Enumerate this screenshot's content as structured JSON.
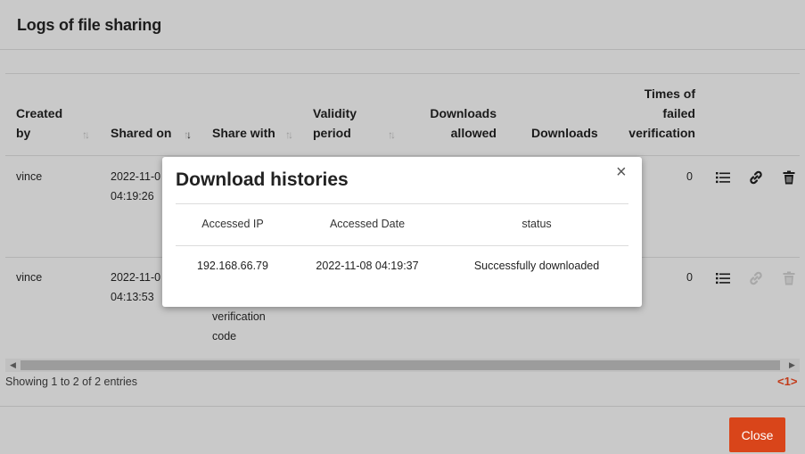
{
  "outer": {
    "title": "Logs of file sharing",
    "columns": {
      "created_by": [
        "Created",
        "by"
      ],
      "shared_on": "Shared on",
      "share_with": "Share with",
      "validity_period": [
        "Validity",
        "period"
      ],
      "downloads_allowed": [
        "Downloads",
        "allowed"
      ],
      "downloads": "Downloads",
      "failed_verification": [
        "Times of",
        "failed",
        "verification"
      ]
    },
    "rows": [
      {
        "created_by": "vince",
        "shared_on": [
          "2022-11-0",
          "04:19:26"
        ],
        "share_with": [],
        "failed": "0"
      },
      {
        "created_by": "vince",
        "shared_on": [
          "2022-11-0",
          "04:13:53"
        ],
        "share_with": [
          "verification",
          "code"
        ],
        "failed": "0"
      }
    ],
    "info": "Showing 1 to 2 of 2 entries",
    "pager": "<1>",
    "close_label": "Close"
  },
  "dialog": {
    "title": "Download histories",
    "close_glyph": "×",
    "headers": {
      "ip": "Accessed IP",
      "date": "Accessed Date",
      "status": "status"
    },
    "rows": [
      {
        "ip": "192.168.66.79",
        "date": "2022-11-08 04:19:37",
        "status": "Successfully downloaded"
      }
    ]
  },
  "icons": {
    "row_actions": [
      "list-icon",
      "link-icon",
      "trash-icon"
    ],
    "sort": "sort-arrows-icon"
  },
  "colors": {
    "accent": "#d9451a",
    "pager": "#c23a18"
  }
}
